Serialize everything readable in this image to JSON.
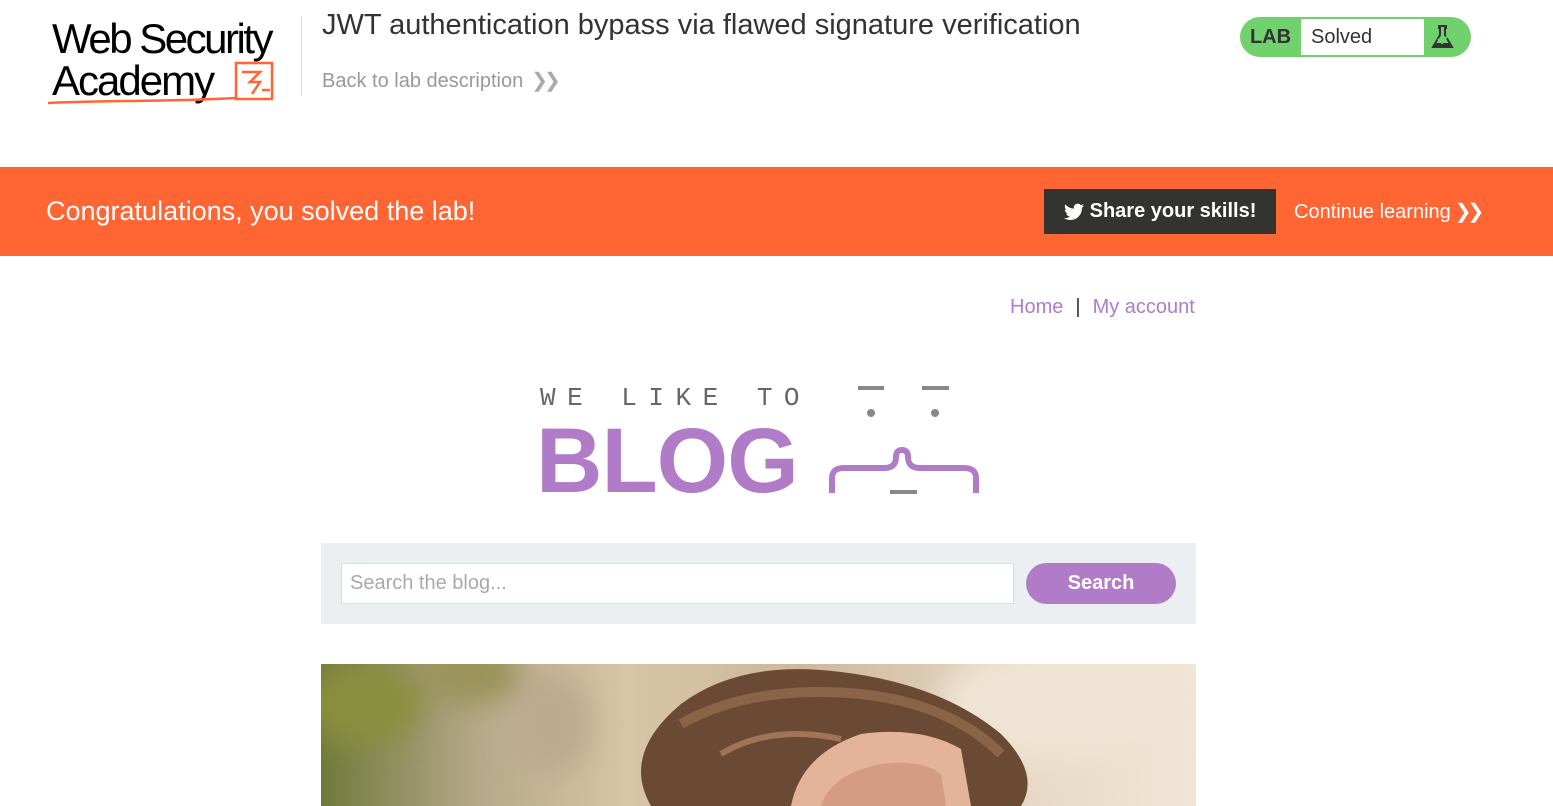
{
  "header": {
    "logo": {
      "line1": "Web Security",
      "line2": "Academy"
    },
    "lab_title": "JWT authentication bypass via flawed signature verification",
    "back_link": "Back to lab description",
    "lab_status": {
      "label": "LAB",
      "state": "Solved",
      "icon": "flask-check-icon"
    }
  },
  "banner": {
    "message": "Congratulations, you solved the lab!",
    "share_label": "Share your skills!",
    "share_icon": "twitter-icon",
    "continue_label": "Continue learning"
  },
  "nav": {
    "home": "Home",
    "separator": "|",
    "account": "My account"
  },
  "blog_logo": {
    "tagline": "WE LIKE TO",
    "word": "BLOG"
  },
  "search": {
    "placeholder": "Search the blog...",
    "value": "",
    "button": "Search"
  },
  "colors": {
    "accent_orange": "#ff6633",
    "blog_purple": "#b07cc8",
    "lab_green": "#70d16d",
    "share_dark": "#333332",
    "search_panel": "#ebeff2"
  }
}
